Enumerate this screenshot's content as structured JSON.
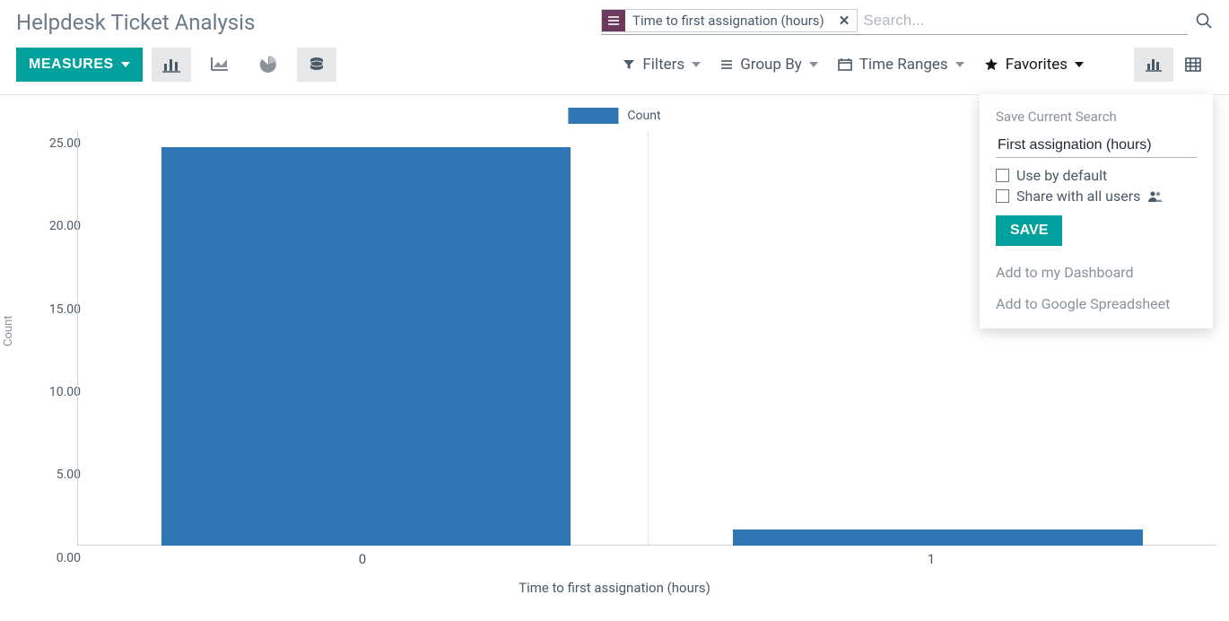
{
  "header": {
    "title": "Helpdesk Ticket Analysis",
    "search": {
      "facet_label": "Time to first assignation (hours)",
      "placeholder": "Search..."
    }
  },
  "toolbar": {
    "measures_label": "MEASURES",
    "filters_label": "Filters",
    "groupby_label": "Group By",
    "timeranges_label": "Time Ranges",
    "favorites_label": "Favorites"
  },
  "favorites_dropdown": {
    "section_title": "Save Current Search",
    "input_value": "First assignation (hours)",
    "use_default_label": "Use by default",
    "share_all_label": "Share with all users",
    "save_label": "SAVE",
    "add_dashboard_label": "Add to my Dashboard",
    "add_spreadsheet_label": "Add to Google Spreadsheet"
  },
  "chart": {
    "legend_label": "Count",
    "ylabel": "Count",
    "xlabel": "Time to first assignation (hours)",
    "yticks": [
      "0.00",
      "5.00",
      "10.00",
      "15.00",
      "20.00",
      "25.00"
    ],
    "xticks": [
      "0",
      "1"
    ]
  },
  "chart_data": {
    "type": "bar",
    "title": "",
    "xlabel": "Time to first assignation (hours)",
    "ylabel": "Count",
    "ylim": [
      0,
      25
    ],
    "categories": [
      "0",
      "1"
    ],
    "series": [
      {
        "name": "Count",
        "values": [
          24,
          1
        ]
      }
    ]
  }
}
